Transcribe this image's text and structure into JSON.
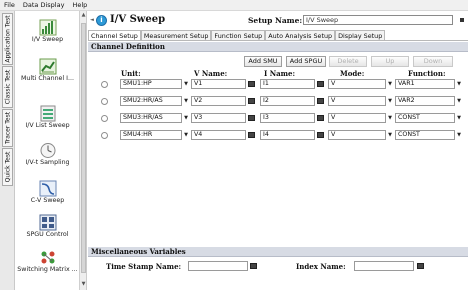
{
  "menubar": {
    "items": [
      "File",
      "Data Display",
      "Help"
    ]
  },
  "vertical_tabs": [
    "Application Test",
    "Classic Test",
    "Tracer Test",
    "Quick Test"
  ],
  "palette": {
    "items": [
      {
        "label": "I/V Sweep",
        "icon": "iv-sweep-icon"
      },
      {
        "label": "Multi Channel I...",
        "icon": "multi-channel-icon"
      },
      {
        "label": "I/V List Sweep",
        "icon": "iv-list-sweep-icon"
      },
      {
        "label": "I/V-t Sampling",
        "icon": "sampling-icon"
      },
      {
        "label": "C-V Sweep",
        "icon": "cv-sweep-icon"
      },
      {
        "label": "SPGU Control",
        "icon": "spgu-control-icon"
      },
      {
        "label": "Switching Matrix ...",
        "icon": "switching-matrix-icon"
      }
    ]
  },
  "header": {
    "title": "I/V Sweep",
    "setup_name_label": "Setup Name:",
    "setup_name_value": "I/V Sweep"
  },
  "tabs": [
    "Channel Setup",
    "Measurement Setup",
    "Function Setup",
    "Auto Analysis Setup",
    "Display Setup"
  ],
  "active_tab": "Channel Setup",
  "channel_definition": {
    "title": "Channel Definition",
    "buttons": {
      "add_smu": "Add SMU",
      "add_spgu": "Add SPGU",
      "delete": "Delete",
      "up": "Up",
      "down": "Down"
    },
    "columns": {
      "unit": "Unit:",
      "vname": "V Name:",
      "iname": "I Name:",
      "mode": "Mode:",
      "function": "Function:"
    },
    "rows": [
      {
        "unit": "SMU1:HP",
        "vname": "V1",
        "iname": "I1",
        "mode": "V",
        "function": "VAR1"
      },
      {
        "unit": "SMU2:HR/AS",
        "vname": "V2",
        "iname": "I2",
        "mode": "V",
        "function": "VAR2"
      },
      {
        "unit": "SMU3:HR/AS",
        "vname": "V3",
        "iname": "I3",
        "mode": "V",
        "function": "CONST"
      },
      {
        "unit": "SMU4:HR",
        "vname": "V4",
        "iname": "I4",
        "mode": "V",
        "function": "CONST"
      }
    ]
  },
  "misc": {
    "title": "Miscellaneous Variables",
    "time_stamp_label": "Time Stamp Name:",
    "time_stamp_value": "",
    "index_label": "Index Name:",
    "index_value": ""
  },
  "colors": {
    "section_bar": "#d7dbe4",
    "info_icon": "#2d9ad7"
  }
}
